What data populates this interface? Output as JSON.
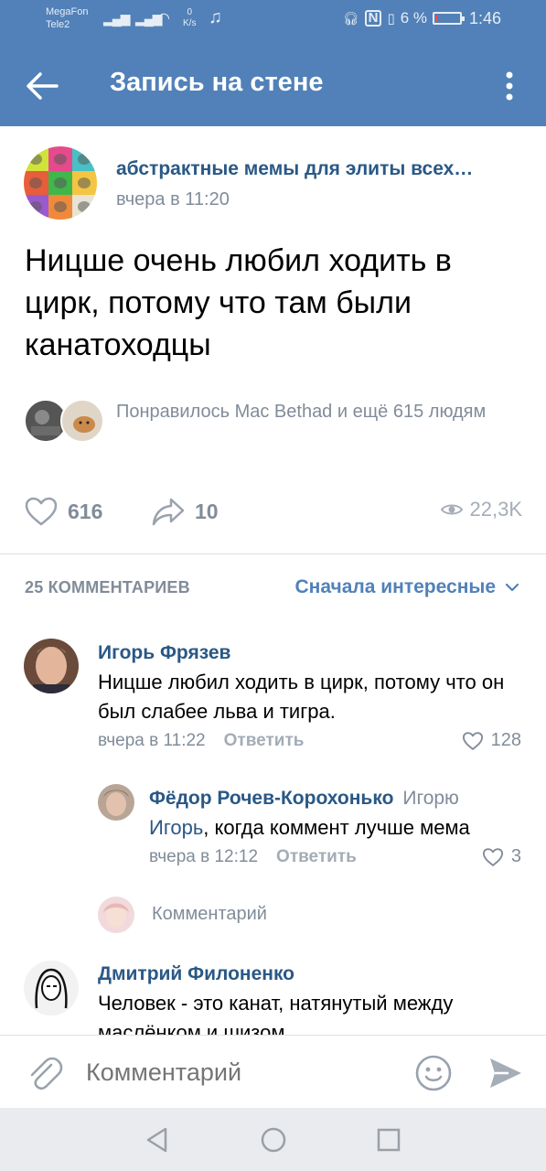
{
  "status_bar": {
    "carrier_1": "MegaFon",
    "carrier_2": "Tele2",
    "net_speed_value": "0",
    "net_speed_unit": "K/s",
    "battery_percent": "6 %",
    "battery_level": 0.06,
    "time": "1:46"
  },
  "app_bar": {
    "title": "Запись на стене",
    "back_icon": "arrow-left-icon",
    "menu_icon": "more-vertical-icon"
  },
  "post": {
    "author": "абстрактные мемы для элиты всех…",
    "time": "вчера в 11:20",
    "text": "Ницше очень любил ходить в цирк, потому что там были канатоходцы",
    "liked_by": "Понравилось Mac Bethad и ещё 615 людям",
    "likes_count": "616",
    "shares_count": "10",
    "views_count": "22,3K"
  },
  "comments_header": {
    "count_label": "25 КОММЕНТАРИЕВ",
    "sort_label": "Сначала интересные"
  },
  "comments": [
    {
      "author": "Игорь Фрязев",
      "text": "Ницше любил ходить в цирк, потому что он был слабее льва и тигра.",
      "time": "вчера в 11:22",
      "reply_label": "Ответить",
      "likes": "128"
    },
    {
      "author": "Фёдор Рочев-Корохонько",
      "addressee": "Игорю",
      "mention": "Игорь",
      "text": ", когда коммент лучше мема",
      "time": "вчера в 12:12",
      "reply_label": "Ответить",
      "likes": "3"
    },
    {
      "author": "Дмитрий Филоненко",
      "text": "Человек - это канат, натянутый между маслёнком и шизом"
    }
  ],
  "reply_field": {
    "placeholder": "Комментарий"
  },
  "composer": {
    "placeholder": "Комментарий"
  },
  "colors": {
    "header_bg": "#5181b8",
    "link": "#2a5885",
    "secondary_text": "#818c99",
    "accent": "#5181b8"
  }
}
